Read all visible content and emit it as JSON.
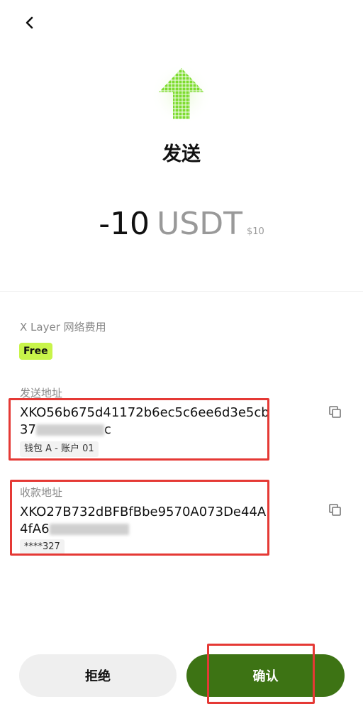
{
  "header": {
    "back_icon": "chevron-left-icon"
  },
  "hero": {
    "icon": "send-arrow-up-icon",
    "icon_color": "#7ddc2f",
    "title": "发送"
  },
  "amount": {
    "value": "-10",
    "currency": "USDT",
    "usd": "$10"
  },
  "fee": {
    "label": "X Layer 网络费用",
    "badge": "Free",
    "badge_color": "#c8f44a"
  },
  "from": {
    "label": "发送地址",
    "address_line1": "XKO56b675d41172b6ec5c6ee6d3e5cb",
    "address_prefix2": "37",
    "address_suffix2": "c",
    "tag": "钱包 A - 账户 01",
    "copy_icon": "copy-icon"
  },
  "to": {
    "label": "收款地址",
    "address_line1": "XKO27B732dBFBfBbe9570A073De44A",
    "address_prefix2": "4fA6",
    "tag": "****327",
    "copy_icon": "copy-icon"
  },
  "actions": {
    "reject": "拒绝",
    "confirm": "确认",
    "confirm_color": "#3d7314"
  },
  "highlight_color": "#e53935"
}
